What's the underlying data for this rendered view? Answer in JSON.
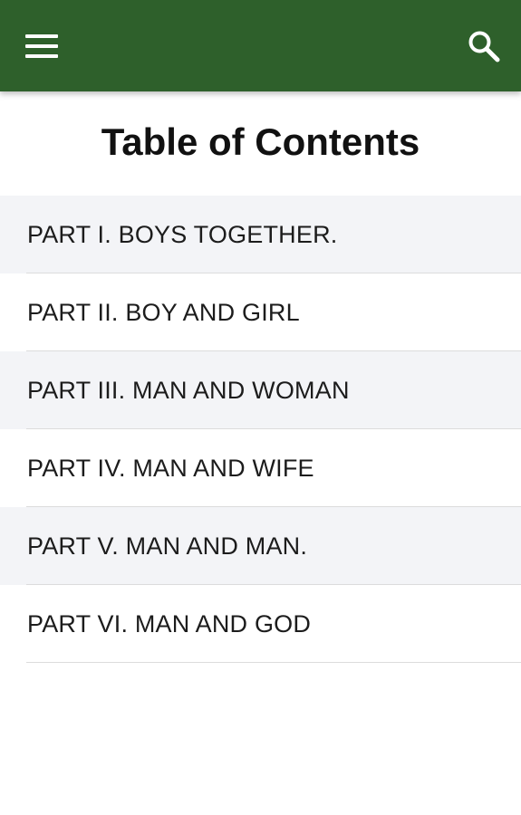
{
  "colors": {
    "app_bar": "#2e602b",
    "icon": "#ffffff",
    "alt_row": "#f3f4f7",
    "divider": "#dcdcdc"
  },
  "app_bar": {
    "menu_icon": "hamburger-menu-icon",
    "search_icon": "search-icon"
  },
  "page": {
    "title": "Table of Contents"
  },
  "toc": {
    "items": [
      {
        "label": "PART I. BOYS TOGETHER."
      },
      {
        "label": "PART II. BOY AND GIRL"
      },
      {
        "label": "PART III. MAN AND WOMAN"
      },
      {
        "label": "PART IV. MAN AND WIFE"
      },
      {
        "label": "PART V. MAN AND MAN."
      },
      {
        "label": "PART VI. MAN AND GOD"
      }
    ]
  }
}
